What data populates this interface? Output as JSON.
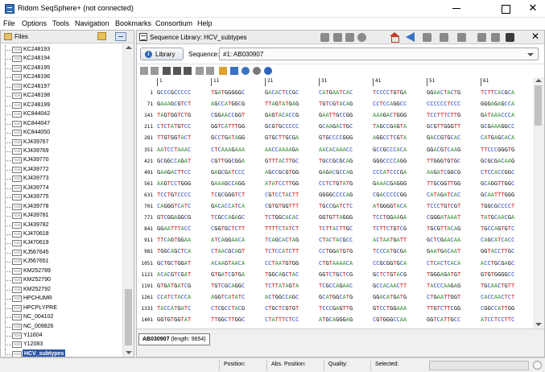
{
  "window": {
    "title": "Ridom SeqSphere+ (not connected)",
    "minimize_glyph": "",
    "maximize_glyph": "",
    "close_glyph": "✕"
  },
  "menu": [
    "File",
    "Options",
    "Tools",
    "Navigation",
    "Bookmarks",
    "Consortium",
    "Help"
  ],
  "files_panel": {
    "title": "Files",
    "file_icon_text": "TCR",
    "items": [
      "KC248193",
      "KC248194",
      "KC248195",
      "KC248196",
      "KC248197",
      "KC248198",
      "KC248199",
      "KC844042",
      "KC844047",
      "KC844050",
      "KJ439767",
      "KJ439769",
      "KJ439770",
      "KJ439772",
      "KJ439773",
      "KJ439774",
      "KJ439775",
      "KJ439778",
      "KJ439781",
      "KJ439782",
      "KJ470618",
      "KJ470619",
      "KJ567645",
      "KJ567651",
      "KM252789",
      "KM252790",
      "KM252792",
      "HPCHUMR",
      "HPCPLYPRE",
      "NC_004102",
      "NC_009826",
      "Y11604",
      "Y12083",
      "HCV_subtypes"
    ],
    "selected": "HCV_subtypes"
  },
  "library_panel": {
    "title": "Sequence Library: HCV_subtypes",
    "library_button": "Library",
    "sequence_label": "Sequence:",
    "sequence_value": "#1: AB030907",
    "ruler": [
      "1",
      "11",
      "21",
      "31",
      "41",
      "51",
      "61"
    ],
    "rows": [
      {
        "pos": "1",
        "blocks": [
          "GCCCGCCCCC",
          "TGATGGGGGC",
          "GACACTCCGC",
          "CATGAATCAC",
          "TCCCCTGTGA",
          "GGAACTACTG",
          "TCTTCACGCA"
        ]
      },
      {
        "pos": "71",
        "blocks": [
          "GAAAGCGTCT",
          "AGCCATGGCG",
          "TTAGTATGAG",
          "TGTCGTACAG",
          "CCTCCAGGCC",
          "CCCCCCTCCC",
          "GGGAGAGCCA"
        ]
      },
      {
        "pos": "141",
        "blocks": [
          "TAGTGGTCTG",
          "CGGAACCGGT",
          "GAGTACACCG",
          "GAATTGCCGG",
          "AAAGACTGGG",
          "TCCTTTCTTG",
          "GATAAACCCA"
        ]
      },
      {
        "pos": "211",
        "blocks": [
          "CTCTATGTCC",
          "GGTCATTTGG",
          "GCGTGCCCCC",
          "GCAAGACTGC",
          "TAGCCGAGTA",
          "GCGTTGGGTT",
          "GCGAAAGGCC"
        ]
      },
      {
        "pos": "281",
        "blocks": [
          "TTGTGGTACT",
          "GCCTGATAGG",
          "GTGCTTGCGA",
          "GTGCCCCGGG",
          "AGGCCTCGTA",
          "GACCGTGCAC",
          "CATGAGCACA"
        ]
      },
      {
        "pos": "351",
        "blocks": [
          "AATCCTAAAC",
          "CTCAAAGAAA",
          "AACCAAAAGA",
          "AACACAAACC",
          "GCCGCCCACA",
          "GGACGTCAAG",
          "TTCCCGGGTG"
        ]
      },
      {
        "pos": "421",
        "blocks": [
          "GCGGCCAGAT",
          "CGTTGGCGGA",
          "GTTTACTTGC",
          "TGCCGCGCAG",
          "GGGCCCCAGG",
          "TTGGGTGTGC",
          "GCGCGACAAG"
        ]
      },
      {
        "pos": "491",
        "blocks": [
          "GAAGACTTCC",
          "GAGCGATCCC",
          "AGCCGCGTGG",
          "GAGACGCCAG",
          "CCCATCCCGA",
          "AAGATCGGCG",
          "CTCCACCGGC"
        ]
      },
      {
        "pos": "561",
        "blocks": [
          "AAGTCCTGGG",
          "GAAAGCCAGG",
          "ATATCCTTGG",
          "CCTCTGTATG",
          "GAAACGAGGG",
          "TTGCGGTTGG",
          "GCAGGTTGGC"
        ]
      },
      {
        "pos": "631",
        "blocks": [
          "TCCTGTCCCC",
          "TCGCGGGTCT",
          "CGTCCTACTT",
          "GGGGCCCCAG",
          "CGACCCCCGG",
          "CATAGATCAC",
          "GCAATTTGGG"
        ]
      },
      {
        "pos": "701",
        "blocks": [
          "CAGGGTCATC",
          "GACACCATCA",
          "CGTGTGGTTT",
          "TGCCGATCTC",
          "ATGGGGTACA",
          "TCCCTGTCGT",
          "TGGCGCCCCT"
        ]
      },
      {
        "pos": "771",
        "blocks": [
          "GTCGGAGGCG",
          "TCGCCAGAGC",
          "TCTGGCACAC",
          "GGTGTTAGGG",
          "TCCTGGAAGA",
          "CGGGATAAAT",
          "TATGCAACGA"
        ]
      },
      {
        "pos": "841",
        "blocks": [
          "GGAATTTACC",
          "CGGTGCTCTT",
          "TTTTCTATCT",
          "TCTTACTTGC",
          "TCTTCTGTCG",
          "TGCGTTACAG",
          "TGCCAGTGTC"
        ]
      },
      {
        "pos": "911",
        "blocks": [
          "TTCAGTGGAA",
          "ATCAGGAACA",
          "TCAGCACTAG",
          "CTACTACGCC",
          "ACTAATGATT",
          "GCTCGAACAA",
          "CAGCATCACC"
        ]
      },
      {
        "pos": "981",
        "blocks": [
          "TGGCAGCTCA",
          "CTAACGCAGT",
          "TCTCCATCTT",
          "CCTGGATGTG",
          "TCCCATGCGA",
          "GAATGACAAT",
          "GGTACCTTGC"
        ]
      },
      {
        "pos": "1051",
        "blocks": [
          "GCTGCTGGAT",
          "ACAAGTAACA",
          "CCTAATGTGG",
          "CTGTAAAACA",
          "CCGCGGTGCA",
          "CTCACTCACA",
          "ACCTGCGAGC"
        ]
      },
      {
        "pos": "1121",
        "blocks": [
          "ACACGTCGAT",
          "GTGATCGTGA",
          "TGGCAGCTAC",
          "GGTCTGCTCG",
          "GCTCTGTACG",
          "TGGGAGATGT",
          "GTGTGGGGCC"
        ]
      },
      {
        "pos": "1191",
        "blocks": [
          "GTGATGATCG",
          "TGTCGCAGGC",
          "TCTTATAGTA",
          "TCGCCAGAAC",
          "GCCACAACTT",
          "TACCCAAGAG",
          "TGCAACTGTT"
        ]
      },
      {
        "pos": "1261",
        "blocks": [
          "CCATCTACCA",
          "AGGTCATATC",
          "ACTGGCCAGC",
          "GCATGGCATG",
          "GGACATGATG",
          "CTGAATTGGT",
          "CACCAACTCT"
        ]
      },
      {
        "pos": "1331",
        "blocks": [
          "TACCATGATC",
          "CTCGCCTACG",
          "CTGCTCGTGT",
          "TCCCGAGTTG",
          "GTCCTGGAAA",
          "TTGTCTTCGG",
          "CGGCCATTGG"
        ]
      },
      {
        "pos": "1401",
        "blocks": [
          "GGTGTGGTAT",
          "TTGGCTTGGC",
          "CTATTTCTCC",
          "ATGCAGGGAG",
          "CGTGGGCCAA",
          "GGTCATTGCC",
          "ATCCTCCTTC"
        ]
      }
    ],
    "seq_info": {
      "accession": "AB030907",
      "length_text": "(length: 9654)"
    }
  },
  "colors": {
    "A": "#2a8a2a",
    "C": "#2645c8",
    "G": "#111111",
    "T": "#d41a1a"
  },
  "status": {
    "position": "Position:",
    "abs_position": "Abs. Position:",
    "quality": "Quality:",
    "selected": "Selected:"
  }
}
